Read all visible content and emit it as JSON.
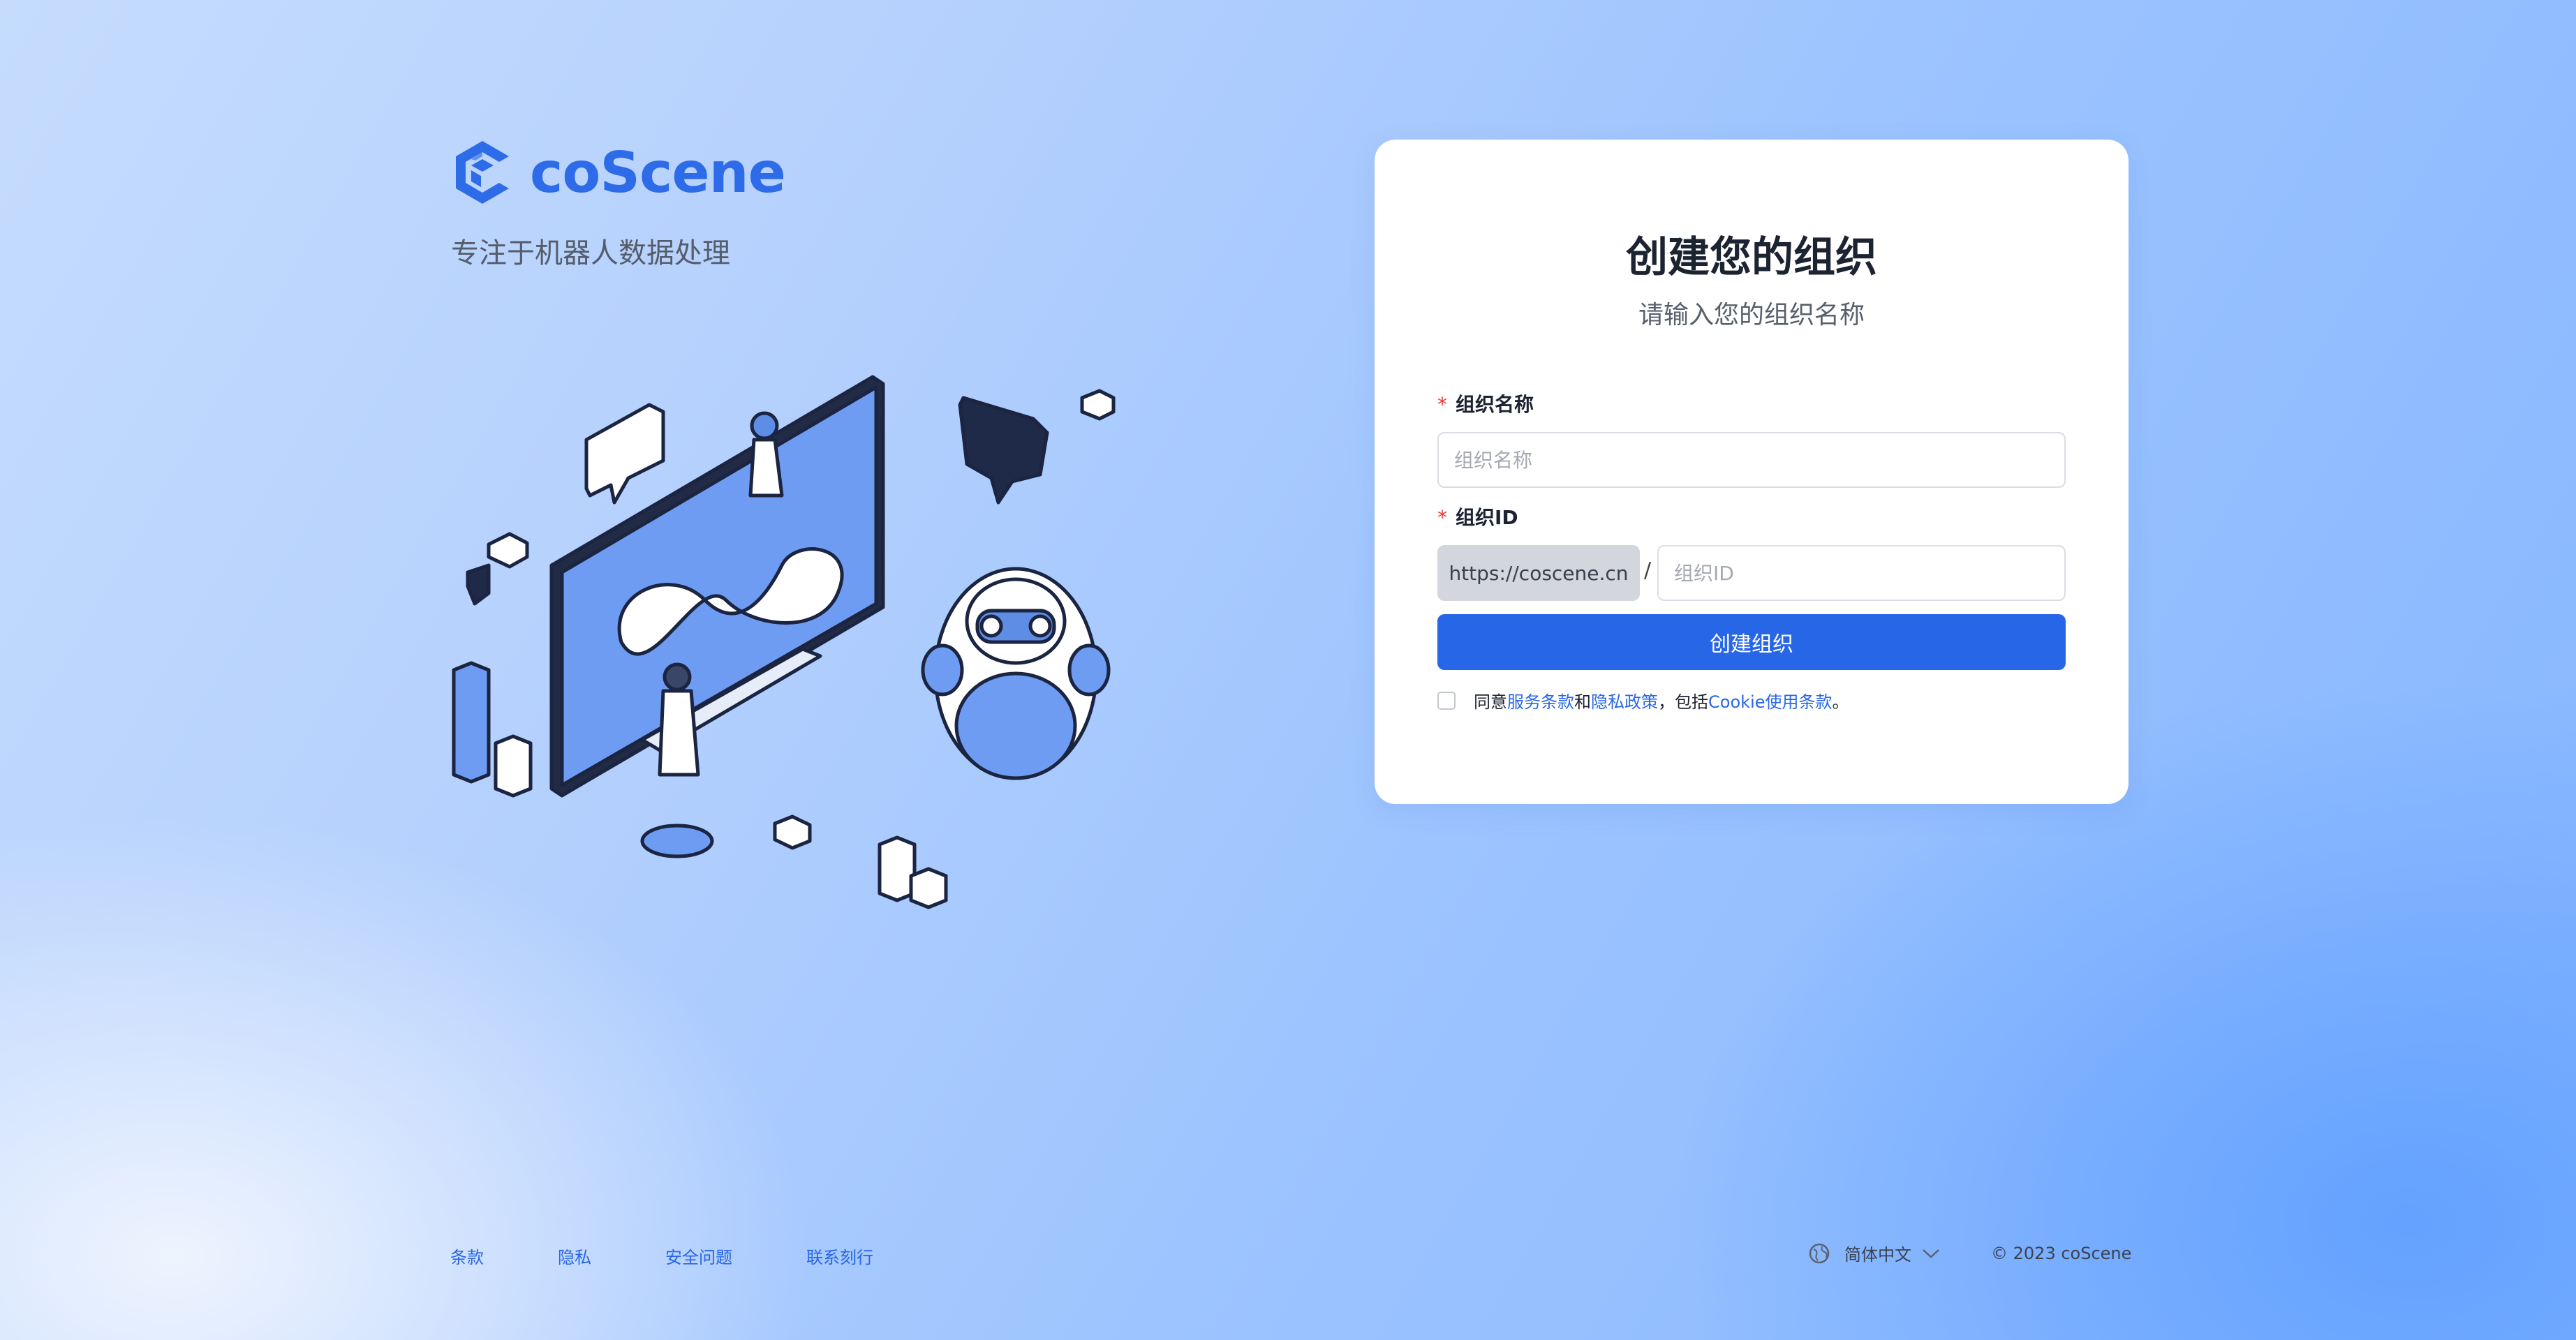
{
  "brand": {
    "name": "coScene",
    "tagline": "专注于机器人数据处理",
    "primary_color": "#2866e8"
  },
  "form": {
    "title": "创建您的组织",
    "subtitle": "请输入您的组织名称",
    "org_name": {
      "label": "组织名称",
      "placeholder": "组织名称",
      "value": ""
    },
    "org_id": {
      "label": "组织ID",
      "prefix": "https://coscene.cn",
      "separator": "/",
      "placeholder": "组织ID",
      "value": ""
    },
    "submit_label": "创建组织",
    "agreement": {
      "checked": false,
      "prefix": "同意",
      "terms": "服务条款",
      "and": "和",
      "privacy": "隐私政策",
      "including": "，包括",
      "cookie": "Cookie使用条款",
      "suffix": "。"
    }
  },
  "footer": {
    "links": [
      "条款",
      "隐私",
      "安全问题",
      "联系刻行"
    ],
    "language": "简体中文",
    "copyright": "© 2023 coScene"
  },
  "icons": [
    "coscene-logo-icon",
    "globe-icon",
    "chevron-down-icon"
  ]
}
